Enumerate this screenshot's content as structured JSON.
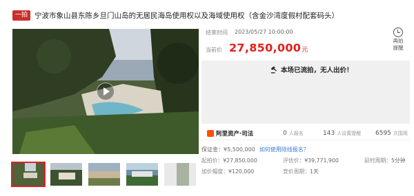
{
  "header": {
    "badge": "一拍",
    "title": "宁波市象山县东陈乡旦门山岛的无居民海岛使用权以及海域使用权（含金沙湾度假村配套码头）"
  },
  "auction": {
    "end_time_label": "结束时间",
    "end_time": "2023/05/27 10:00:00",
    "current_price_label": "当前价",
    "current_price": "27,850,000",
    "currency_unit": "元",
    "remind_line1": "再拍",
    "remind_line2": "提醒",
    "status": "本场已流拍，无人出价！"
  },
  "stats": {
    "platform": "阿里资产·司法",
    "signups": "0",
    "signups_label": "人报名",
    "reminders": "143",
    "reminders_label": "人设置提醒",
    "views": "6595",
    "views_label": "次围观"
  },
  "details": {
    "deposit_label": "保证金：",
    "deposit": "¥5,500,000",
    "deposit_link": "如何使用除线报名？",
    "start_price_label": "起拍价：",
    "start_price": "¥27,850,000",
    "appraisal_label": "评估价：",
    "appraisal": "¥39,771,900",
    "delay_label": "延时周期：",
    "delay": "5分钟",
    "increment_label": "加价幅度：",
    "increment": "¥120,000",
    "cycle_label": "竞价周期：",
    "cycle": "1天"
  },
  "thumbnails_count": 5
}
